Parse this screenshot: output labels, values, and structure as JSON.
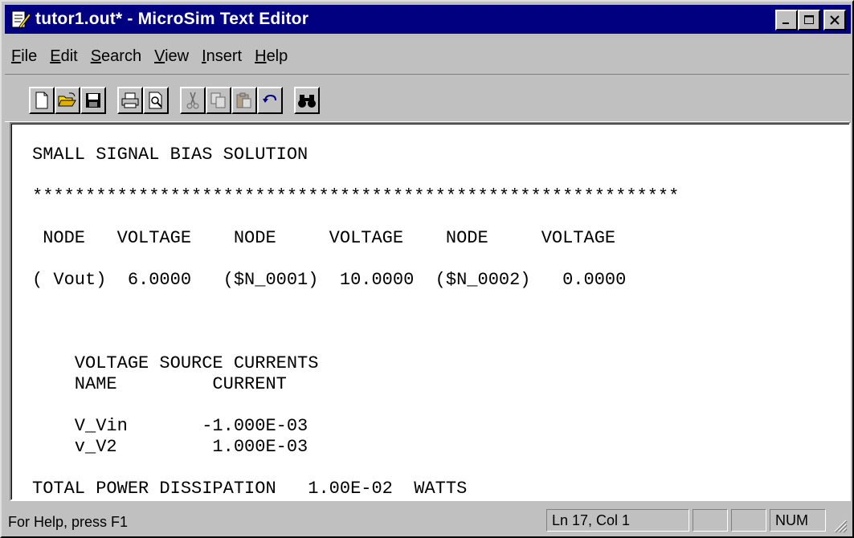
{
  "window": {
    "title": "tutor1.out* - MicroSim Text Editor",
    "minimize_label": "minimize",
    "maximize_label": "maximize",
    "close_label": "close"
  },
  "menu": {
    "items": [
      {
        "underline": "F",
        "rest": "ile"
      },
      {
        "underline": "E",
        "rest": "dit"
      },
      {
        "underline": "S",
        "rest": "earch"
      },
      {
        "underline": "V",
        "rest": "iew"
      },
      {
        "underline": "I",
        "rest": "nsert"
      },
      {
        "underline": "H",
        "rest": "elp"
      }
    ]
  },
  "toolbar": {
    "buttons": [
      "new-icon",
      "open-icon",
      "save-icon",
      "print-icon",
      "print-preview-icon",
      "cut-icon",
      "copy-icon",
      "paste-icon",
      "undo-icon",
      "find-icon"
    ]
  },
  "editor": {
    "lines": [
      "SMALL SIGNAL BIAS SOLUTION",
      "",
      "*************************************************************",
      "",
      " NODE   VOLTAGE    NODE     VOLTAGE    NODE     VOLTAGE",
      "",
      "( Vout)  6.0000   ($N_0001)  10.0000  ($N_0002)   0.0000",
      "",
      "",
      "",
      "    VOLTAGE SOURCE CURRENTS",
      "    NAME         CURRENT",
      "",
      "    V_Vin       -1.000E-03",
      "    v_V2         1.000E-03",
      "",
      "TOTAL POWER DISSIPATION   1.00E-02  WATTS"
    ]
  },
  "status": {
    "help": "For Help, press F1",
    "position": "Ln 17, Col 1",
    "pane2": "",
    "pane3": "",
    "num": "NUM"
  }
}
